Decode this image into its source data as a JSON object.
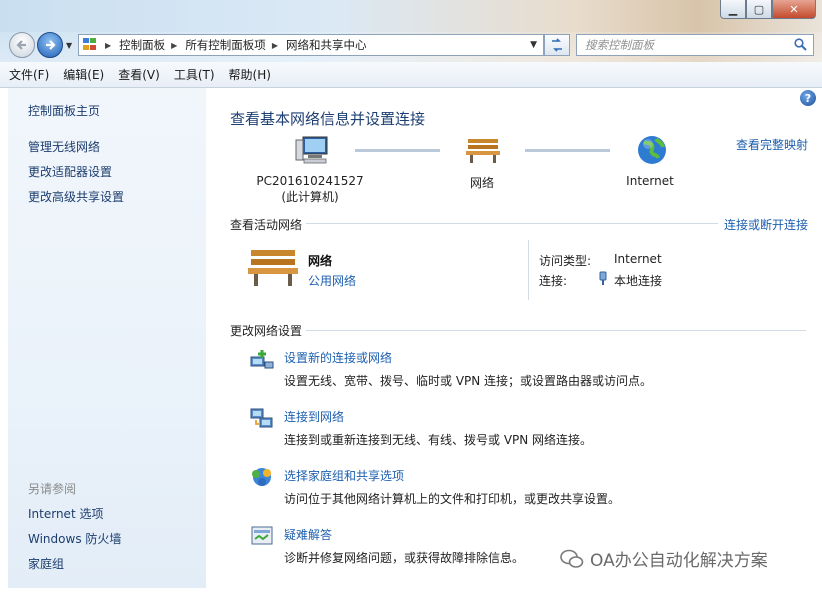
{
  "window": {
    "minimize": "▁",
    "maximize": "▢",
    "close": "✕"
  },
  "address": {
    "crumbs": [
      "控制面板",
      "所有控制面板项",
      "网络和共享中心"
    ]
  },
  "search": {
    "placeholder": "搜索控制面板"
  },
  "menu": [
    "文件(F)",
    "编辑(E)",
    "查看(V)",
    "工具(T)",
    "帮助(H)"
  ],
  "sidebar": {
    "home": "控制面板主页",
    "links": [
      "管理无线网络",
      "更改适配器设置",
      "更改高级共享设置"
    ],
    "see_also_title": "另请参阅",
    "see_also": [
      "Internet 选项",
      "Windows 防火墙",
      "家庭组"
    ]
  },
  "main": {
    "title": "查看基本网络信息并设置连接",
    "full_map": "查看完整映射",
    "nodes": [
      {
        "label": "PC201610241527",
        "sub": "(此计算机)"
      },
      {
        "label": "网络",
        "sub": ""
      },
      {
        "label": "Internet",
        "sub": ""
      }
    ],
    "active_title": "查看活动网络",
    "connect_disconnect": "连接或断开连接",
    "active": {
      "name": "网络",
      "type": "公用网络",
      "access_type_label": "访问类型:",
      "access_type_value": "Internet",
      "connection_label": "连接:",
      "connection_value": "本地连接"
    },
    "change_title": "更改网络设置",
    "tasks": [
      {
        "link": "设置新的连接或网络",
        "desc": "设置无线、宽带、拨号、临时或 VPN 连接；或设置路由器或访问点。"
      },
      {
        "link": "连接到网络",
        "desc": "连接到或重新连接到无线、有线、拨号或 VPN 网络连接。"
      },
      {
        "link": "选择家庭组和共享选项",
        "desc": "访问位于其他网络计算机上的文件和打印机，或更改共享设置。"
      },
      {
        "link": "疑难解答",
        "desc": "诊断并修复网络问题，或获得故障排除信息。"
      }
    ]
  },
  "watermark": {
    "text": "OA办公自动化解决方案"
  }
}
